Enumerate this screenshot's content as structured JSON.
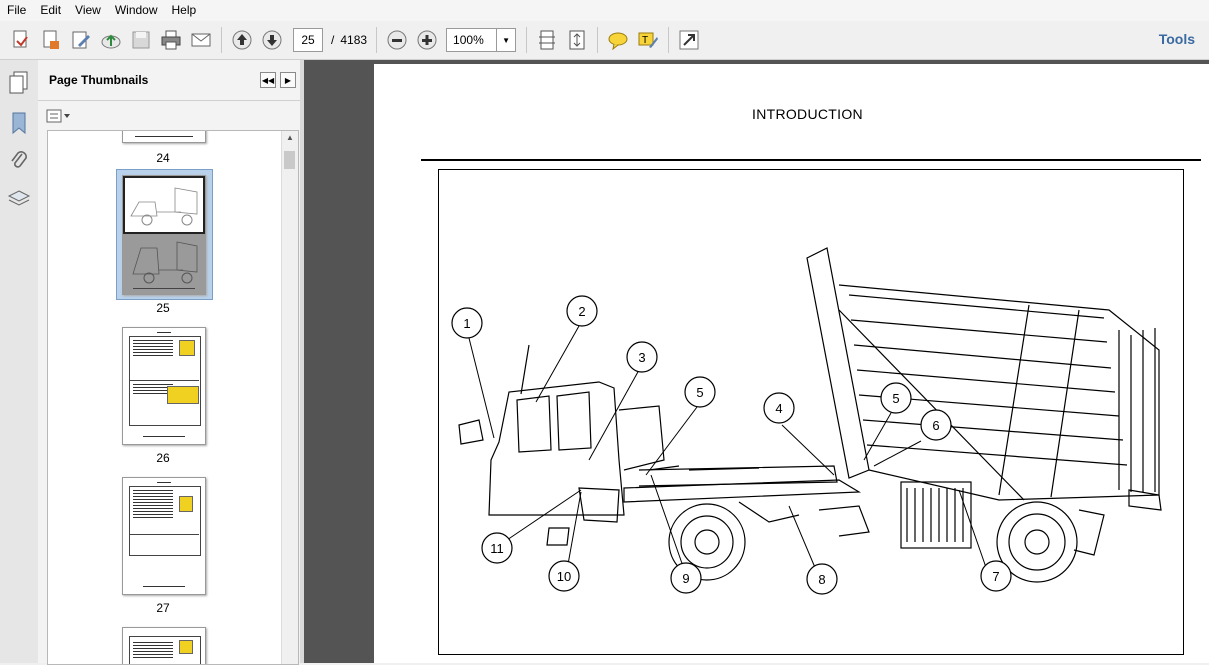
{
  "menu": [
    "File",
    "Edit",
    "View",
    "Window",
    "Help"
  ],
  "toolbar": {
    "current_page": "25",
    "separator": "/",
    "page_count": "4183",
    "zoom": "100%",
    "tools_label": "Tools"
  },
  "panel": {
    "title": "Page Thumbnails",
    "thumbnails": [
      "24",
      "25",
      "26",
      "27"
    ]
  },
  "document": {
    "heading": "INTRODUCTION",
    "callouts": [
      "1",
      "2",
      "3",
      "4",
      "5",
      "5",
      "6",
      "7",
      "8",
      "9",
      "10",
      "11"
    ]
  }
}
